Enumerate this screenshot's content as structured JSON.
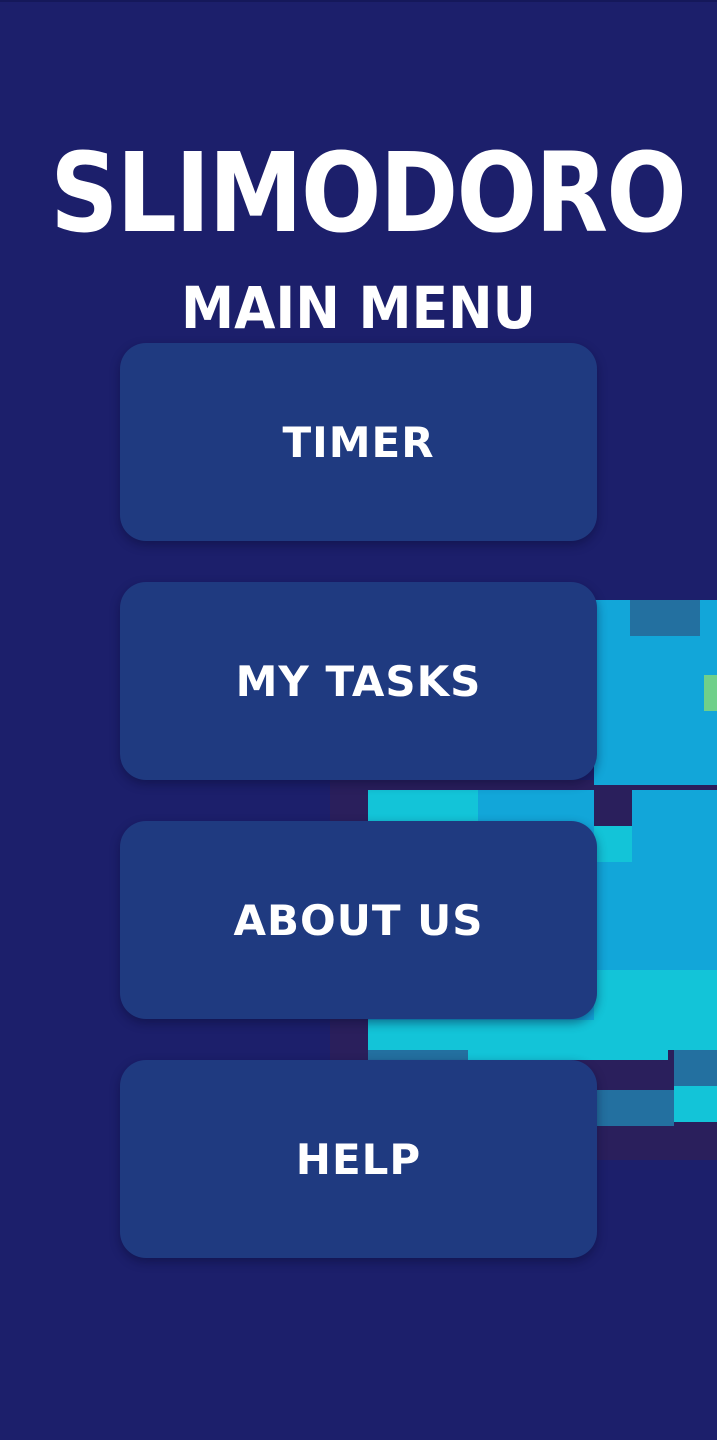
{
  "app": {
    "title": "SLIMODORO",
    "subtitle": "MAIN MENU"
  },
  "menu": {
    "items": [
      {
        "label": "TIMER"
      },
      {
        "label": "MY TASKS"
      },
      {
        "label": "ABOUT US"
      },
      {
        "label": "HELP"
      }
    ]
  },
  "colors": {
    "background": "#1c1f6b",
    "button": "#1f3a80",
    "text": "#ffffff",
    "slime_main": "#12a6d9",
    "slime_light": "#13c4d8",
    "slime_dark": "#2370a0",
    "slime_outline": "#2a1f5c"
  }
}
